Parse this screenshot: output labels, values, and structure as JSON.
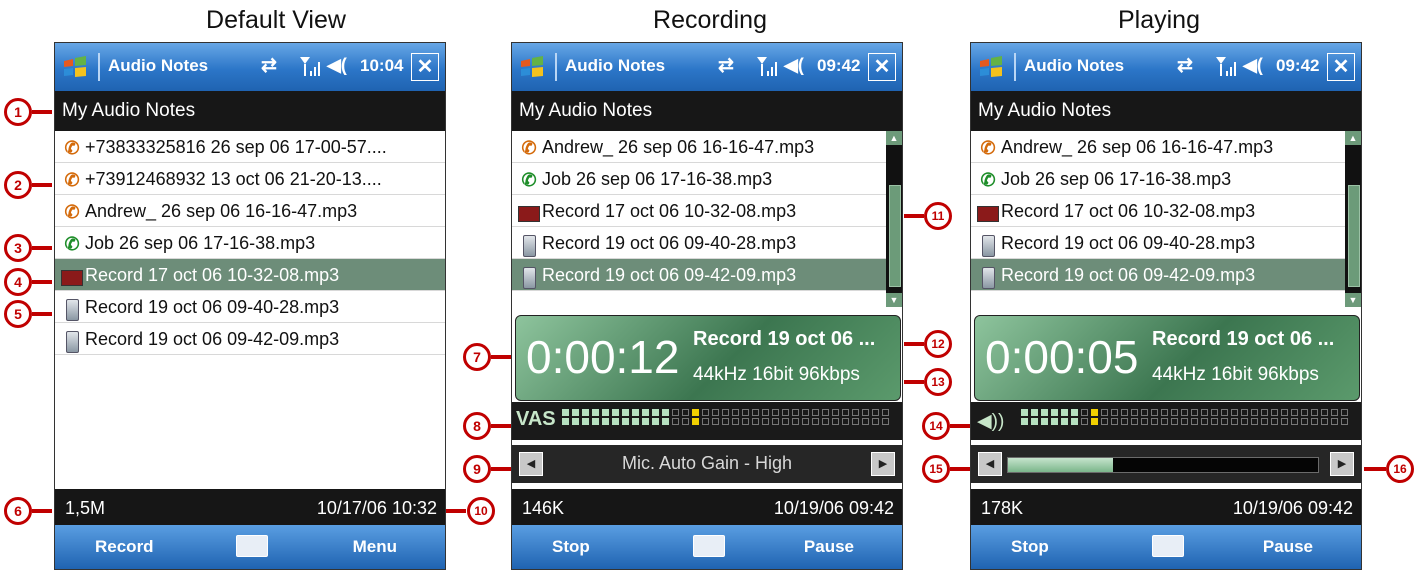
{
  "headings": {
    "default": "Default View",
    "recording": "Recording",
    "playing": "Playing"
  },
  "common": {
    "app_title": "Audio Notes",
    "header": "My Audio Notes"
  },
  "panels": {
    "default": {
      "clock": "10:04",
      "items": [
        {
          "icon": "phone-out-icon",
          "text": "+73833325816 26 sep 06 17-00-57...."
        },
        {
          "icon": "phone-out-icon",
          "text": "+73912468932 13 oct 06 21-20-13...."
        },
        {
          "icon": "phone-out-icon",
          "text": "Andrew_ 26 sep 06 16-16-47.mp3"
        },
        {
          "icon": "phone-in-icon",
          "text": "Job 26 sep 06 17-16-38.mp3"
        },
        {
          "icon": "record-icon",
          "text": "Record 17 oct 06 10-32-08.mp3"
        },
        {
          "icon": "device-icon",
          "text": "Record 19 oct 06 09-40-28.mp3"
        },
        {
          "icon": "device-icon",
          "text": "Record 19 oct 06 09-42-09.mp3"
        }
      ],
      "status_left": "1,5M",
      "status_right": "10/17/06 10:32",
      "softkey_left": "Record",
      "softkey_right": "Menu"
    },
    "recording": {
      "clock": "09:42",
      "items": [
        {
          "icon": "phone-out-icon",
          "text": "Andrew_ 26 sep 06 16-16-47.mp3"
        },
        {
          "icon": "phone-in-icon",
          "text": "Job 26 sep 06 17-16-38.mp3"
        },
        {
          "icon": "record-icon",
          "text": "Record 17 oct 06 10-32-08.mp3"
        },
        {
          "icon": "device-icon",
          "text": "Record 19 oct 06 09-40-28.mp3"
        },
        {
          "icon": "device-icon",
          "text": "Record 19 oct 06 09-42-09.mp3"
        }
      ],
      "time": "0:00:12",
      "track": "Record 19 oct 06 ...",
      "format": "44kHz 16bit 96kbps",
      "meter_label": "VAS",
      "gain": "Mic. Auto Gain - High",
      "status_left": "146K",
      "status_right": "10/19/06 09:42",
      "softkey_left": "Stop",
      "softkey_right": "Pause"
    },
    "playing": {
      "clock": "09:42",
      "items": [
        {
          "icon": "phone-out-icon",
          "text": "Andrew_ 26 sep 06 16-16-47.mp3"
        },
        {
          "icon": "phone-in-icon",
          "text": "Job 26 sep 06 17-16-38.mp3"
        },
        {
          "icon": "record-icon",
          "text": "Record 17 oct 06 10-32-08.mp3"
        },
        {
          "icon": "device-icon",
          "text": "Record 19 oct 06 09-40-28.mp3"
        },
        {
          "icon": "device-icon",
          "text": "Record 19 oct 06 09-42-09.mp3"
        }
      ],
      "time": "0:00:05",
      "track": "Record 19 oct 06 ...",
      "format": "44kHz 16bit 96kbps",
      "progress": 0.34,
      "status_left": "178K",
      "status_right": "10/19/06 09:42",
      "softkey_left": "Stop",
      "softkey_right": "Pause"
    }
  },
  "callouts": [
    "1",
    "2",
    "3",
    "4",
    "5",
    "6",
    "7",
    "8",
    "9",
    "10",
    "11",
    "12",
    "13",
    "14",
    "15",
    "16"
  ]
}
